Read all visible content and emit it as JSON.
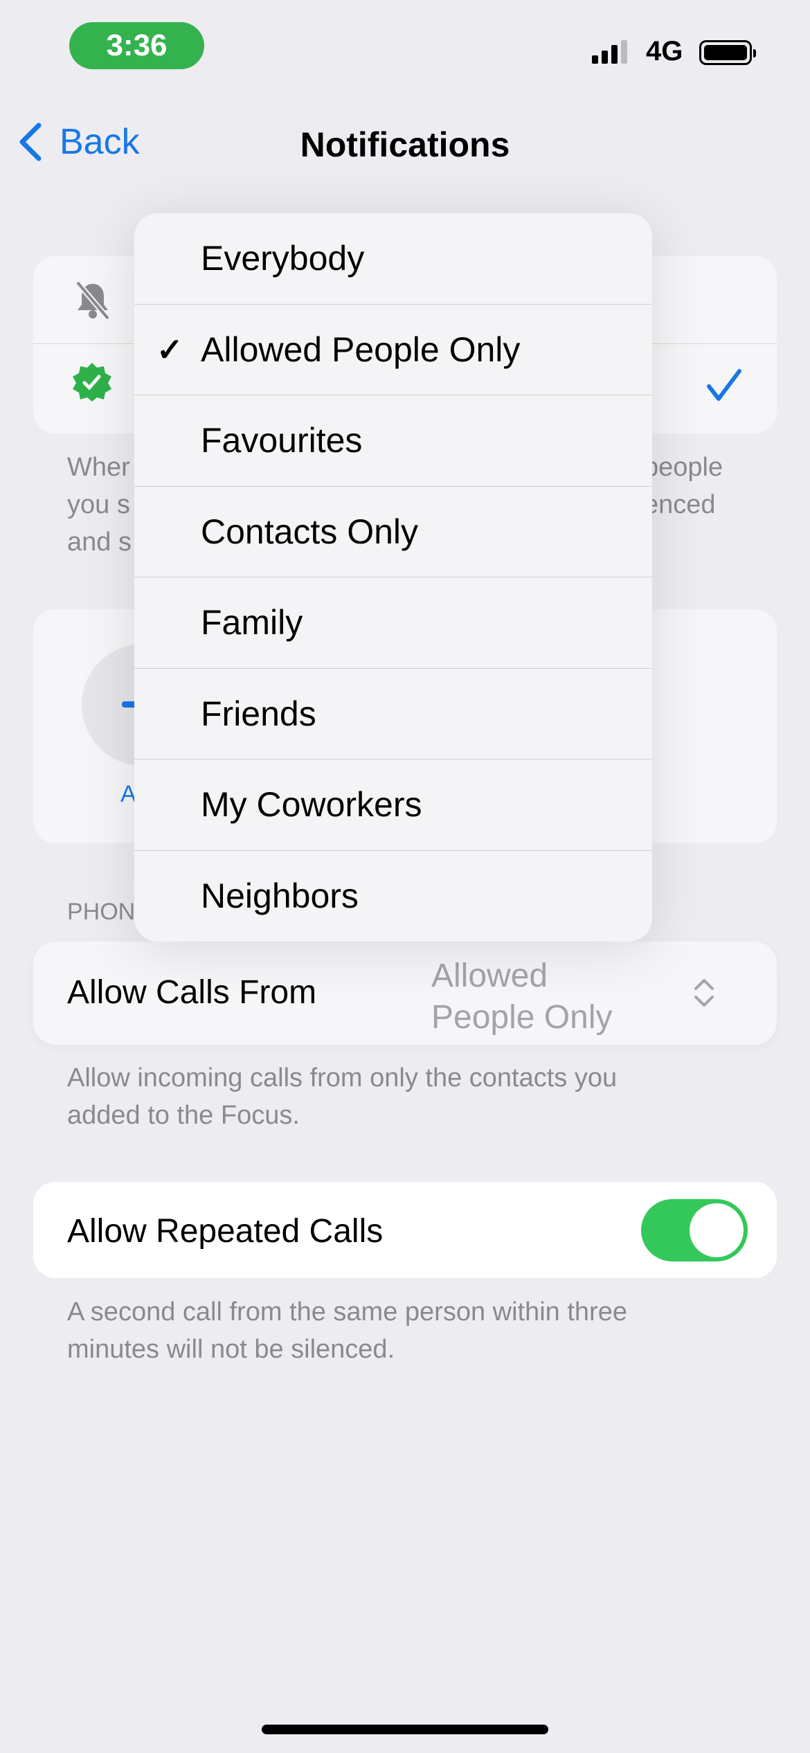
{
  "status": {
    "time": "3:36",
    "network": "4G"
  },
  "nav": {
    "back": "Back",
    "title": "Notifications"
  },
  "background": {
    "footer_fragments_left": [
      "Wher",
      "you s",
      "and s"
    ],
    "footer_fragments_right": [
      "people",
      "enced"
    ],
    "add_label_fragment": "A",
    "section_fragment": "PHON"
  },
  "menu": {
    "selected": "Allowed People Only",
    "items": [
      "Everybody",
      "Allowed People Only",
      "Favourites",
      "Contacts Only",
      "Family",
      "Friends",
      "My Coworkers",
      "Neighbors"
    ]
  },
  "calls": {
    "label": "Allow Calls From",
    "value_line1": "Allowed",
    "value_line2": "People Only",
    "footer_line1": "Allow incoming calls from only the contacts you",
    "footer_line2": "added to the Focus."
  },
  "repeated": {
    "label": "Allow Repeated Calls",
    "enabled": true,
    "footer_line1": "A second call from the same person within three",
    "footer_line2": "minutes will not be silenced."
  },
  "colors": {
    "accent": "#1877e6",
    "toggle_on": "#34c759",
    "time_pill": "#34b24e"
  }
}
